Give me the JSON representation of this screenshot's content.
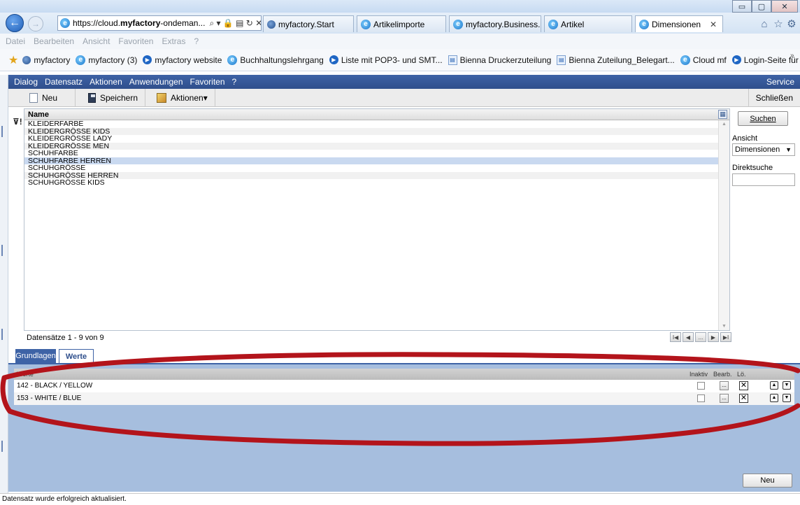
{
  "window": {
    "controls": [
      "▭",
      "▢",
      "✕"
    ]
  },
  "browser": {
    "address": {
      "prefix": "https://cloud.",
      "bold": "myfactory",
      "suffix": "-ondeman...",
      "icons": "⌕ ▾ 🔒 ▤ ↻ ✕"
    },
    "tabs": [
      {
        "label": "myfactory.Start",
        "icon": "myfactory-icon"
      },
      {
        "label": "Artikelimporte",
        "icon": "ie-icon"
      },
      {
        "label": "myfactory.Business...",
        "icon": "ie-icon"
      },
      {
        "label": "Artikel",
        "icon": "ie-icon"
      },
      {
        "label": "Dimensionen",
        "icon": "ie-icon",
        "close": "✕"
      }
    ],
    "menu": [
      "Datei",
      "Bearbeiten",
      "Ansicht",
      "Favoriten",
      "Extras",
      "?"
    ],
    "favorites": [
      {
        "label": "myfactory",
        "icon": "myfactory-icon"
      },
      {
        "label": "myfactory (3)",
        "icon": "ie-icon"
      },
      {
        "label": "myfactory website",
        "icon": "arrow-icon"
      },
      {
        "label": "Buchhaltungslehrgang",
        "icon": "ie-icon"
      },
      {
        "label": "Liste mit POP3- und SMT...",
        "icon": "arrow-icon"
      },
      {
        "label": "Bienna Druckerzuteilung",
        "icon": "page-icon"
      },
      {
        "label": "Bienna Zuteilung_Belegart...",
        "icon": "page-icon"
      },
      {
        "label": "Cloud mf",
        "icon": "ie-icon"
      },
      {
        "label": "Login-Seite für Partner",
        "icon": "arrow-icon"
      }
    ],
    "more": "»"
  },
  "app": {
    "menu": [
      "Dialog",
      "Datensatz",
      "Aktionen",
      "Anwendungen",
      "Favoriten",
      "?"
    ],
    "service": "Service",
    "toolbar": {
      "new": "Neu",
      "save": "Speichern",
      "actions": "Aktionen▾",
      "close": "Schließen"
    },
    "grid": {
      "header": "Name",
      "rows": [
        "KLEIDERFARBE",
        "KLEIDERGRÖSSE KIDS",
        "KLEIDERGRÖSSE LADY",
        "KLEIDERGRÖSSE MEN",
        "SCHUHFARBE",
        "SCHUHFARBE HERREN",
        "SCHUHGRÖSSE",
        "SCHUHGRÖSSE HERREN",
        "SCHUHGRÖSSE KIDS"
      ],
      "selected_index": 5,
      "count": "Datensätze 1 - 9 von 9",
      "pager": [
        "I◀",
        "◀",
        "...",
        "▶",
        "▶I"
      ]
    },
    "right": {
      "search": "Suchen",
      "view_label": "Ansicht",
      "view_value": "Dimensionen",
      "direct_label": "Direktsuche"
    },
    "tabs": {
      "basics": "Grundlagen",
      "values": "Werte"
    },
    "values": {
      "header": "Werte",
      "col_inactive": "Inaktiv",
      "col_edit": "Bearb.",
      "col_delete": "Lö.",
      "rows": [
        "142 - BLACK / YELLOW",
        "153 - WHITE / BLUE"
      ],
      "new": "Neu"
    },
    "status": "Datensatz wurde erfolgreich aktualisiert."
  },
  "colors": {
    "accent": "#3e63a6",
    "selection": "#c9d9f0",
    "annotation": "#b3141b",
    "panel": "#a6bede"
  }
}
